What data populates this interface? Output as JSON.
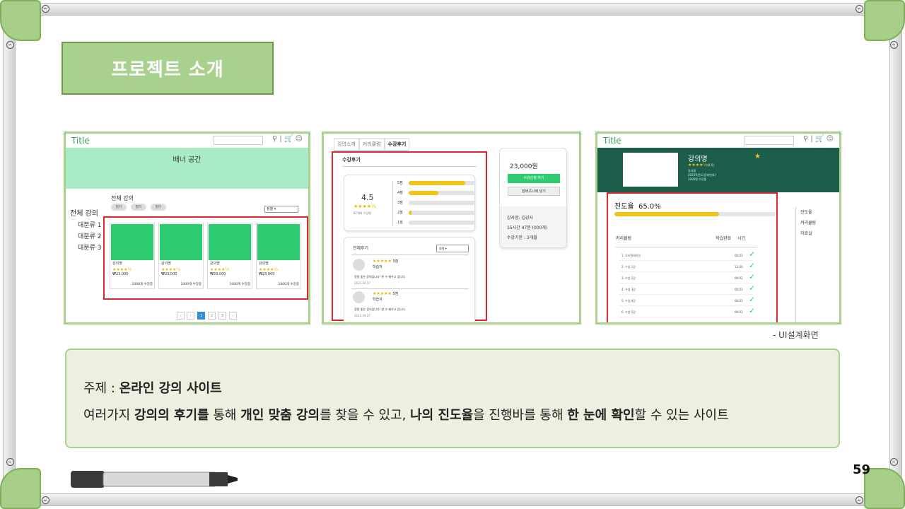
{
  "slide": {
    "title": "프로젝트 소개",
    "caption": "- UI설계화면",
    "page_number": "59"
  },
  "shot1": {
    "title": "Title",
    "banner": "배너 공간",
    "section_title": "전체 강의",
    "chips": [
      "필터",
      "필터",
      "필터"
    ],
    "sort": "정렬",
    "side_heading": "전체 강의",
    "side_items": [
      "대분류 1",
      "대분류 2",
      "대분류 3"
    ],
    "cards": [
      {
        "name": "강의명",
        "stars": "★★★★½",
        "price": "₩23,000",
        "badge": "1000개 수강중"
      },
      {
        "name": "강의명",
        "stars": "★★★★½",
        "price": "₩23,000",
        "badge": "1000개 수강중"
      },
      {
        "name": "강의명",
        "stars": "★★★★½",
        "price": "₩23,000",
        "badge": "1000개 수강중"
      },
      {
        "name": "강의명",
        "stars": "★★★★½",
        "price": "₩23,000",
        "badge": "1000개 수강중"
      }
    ],
    "pages": [
      "‹",
      "‹",
      "1",
      "2",
      "3",
      "›"
    ],
    "active_page": 2
  },
  "shot2": {
    "tabs": [
      "강의소개",
      "커리큘럼",
      "수강후기"
    ],
    "active_tab": 2,
    "review_title": "수강후기",
    "rating": "4.5",
    "rating_stars": "★★★★½",
    "rating_count": "87개의 수강평",
    "distribution": [
      {
        "label": "5점",
        "fraction": 0.85
      },
      {
        "label": "4점",
        "fraction": 0.45
      },
      {
        "label": "3점",
        "fraction": 0.0
      },
      {
        "label": "2점",
        "fraction": 0.05
      },
      {
        "label": "1점",
        "fraction": 0.0
      }
    ],
    "all_reviews_title": "전체후기",
    "review_sort": "정렬",
    "reviews": [
      {
        "stars": "★★★★★",
        "score": "5점",
        "author": "학습자",
        "text": "정말 좋은 강의입니다! 한 수 배우고 갑니다.",
        "date": "2023.04.27"
      },
      {
        "stars": "★★★★★",
        "score": "5점",
        "author": "학습자",
        "text": "정말 좋은 강의입니다! 한 수 배우고 갑니다.",
        "date": "2023.04.27"
      }
    ],
    "price": "23,000원",
    "enroll_button": "수강신청 하기",
    "cart_button": "장바구니에 넣기",
    "info": [
      "강사명: 김강사",
      "15시간 47분 (000개)",
      "수강기한 : 3개월"
    ]
  },
  "shot3": {
    "title": "Title",
    "course_name": "강의명",
    "course_stars": "★★★★½",
    "course_rating": "(4.5)",
    "course_meta": [
      "강사명",
      "2023학년도(강좌번호)",
      "1000명 수강중"
    ],
    "progress_label": "진도율",
    "progress_value": "65.0%",
    "progress_fraction": 0.65,
    "curriculum_header": "커리큘럼",
    "done_header": "학습완료",
    "time_header": "시간",
    "rows": [
      {
        "name": "1. 오리엔테이션",
        "time": "06:03"
      },
      {
        "name": "2. 수업 1강",
        "time": "12:00"
      },
      {
        "name": "3. 수업 2강",
        "time": "06:02"
      },
      {
        "name": "4. 수업 3강",
        "time": "06:03"
      },
      {
        "name": "5. 수업 4강",
        "time": "06:03"
      },
      {
        "name": "6. 수업 5강",
        "time": "06:03"
      }
    ],
    "menu": [
      "진도율",
      "커리큘럼",
      "자료실"
    ]
  },
  "info": {
    "topic_prefix": "주제 : ",
    "topic": "온라인 강의 사이트",
    "desc_1": "여러가지 ",
    "desc_b1": "강의의 후기를",
    "desc_2": " 통해 ",
    "desc_b2": "개인 맞춤 강의",
    "desc_3": "를 찾을 수 있고, ",
    "desc_b3": "나의 진도율",
    "desc_4": "을 진행바를 통해 ",
    "desc_b4": "한 눈에 확인",
    "desc_5": "할 수 있는 사이트"
  },
  "colors": {
    "accent_green": "#a9d18e",
    "card_green": "#2ecc71",
    "highlight_red": "#e0262c",
    "progress_yellow": "#f0c419",
    "dark_banner": "#1d5d4b"
  }
}
